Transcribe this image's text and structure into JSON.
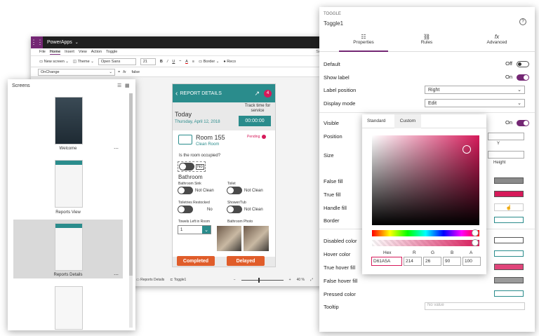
{
  "studio": {
    "app_name": "PowerApps",
    "user_hint": "SmartHo",
    "menu": [
      "File",
      "Home",
      "Insert",
      "View",
      "Action",
      "Toggle"
    ],
    "ribbon": {
      "new_screen": "New screen",
      "theme": "Theme",
      "font": "Open Sans",
      "font_size": "21",
      "bold": "B",
      "italic": "/",
      "underline": "U",
      "strike": "⎯",
      "font_color": "A",
      "align": "≡",
      "border": "Border",
      "record": "Reco"
    },
    "formula": {
      "property": "OnChange",
      "equals": "=",
      "fx": "fx",
      "value": "false"
    },
    "status": {
      "screen": "Reports Details",
      "control": "Toggle1",
      "zoom": "40 %"
    }
  },
  "screens_panel": {
    "title": "Screens",
    "items": [
      {
        "label": "Welcome"
      },
      {
        "label": "Reports View"
      },
      {
        "label": "Reports Details"
      },
      {
        "label": ""
      }
    ]
  },
  "app_screen": {
    "header": "REPORT DETAILS",
    "badge": "4",
    "today": "Today",
    "date": "Thursday, April 12, 2018",
    "track_label": "Track time for service",
    "timer": "00:00:00",
    "room": "Room 155",
    "room_sub": "Clean Room",
    "status": "Pending",
    "occupied_q": "Is the room occupied?",
    "occupied_val": "No",
    "section": "Bathroom",
    "sink_label": "Bathroom Sink",
    "sink_val": "Not Clean",
    "toilet_label": "Toilet",
    "toilet_val": "Not Clean",
    "toiletries_label": "Toiletries Restocked",
    "toiletries_val": "No",
    "shower_label": "Shower/Tub",
    "shower_val": "Not Clean",
    "towels_label": "Towels Left in Room",
    "towels_val": "1",
    "photo_label": "Bathroom Photo",
    "completed": "Completed",
    "delayed": "Delayed"
  },
  "props": {
    "kind": "TOGGLE",
    "name": "Toggle1",
    "help": "?",
    "tabs": [
      "Properties",
      "Rules",
      "Advanced"
    ],
    "default_label": "Default",
    "default_val": "Off",
    "show_label": "Show label",
    "show_val": "On",
    "label_pos": "Label position",
    "label_pos_val": "Right",
    "display_mode": "Display mode",
    "display_mode_val": "Edit",
    "visible": "Visible",
    "visible_val": "On",
    "position": "Position",
    "y": "Y",
    "size": "Size",
    "height": "Height",
    "false_fill": "False fill",
    "true_fill": "True fill",
    "handle_fill": "Handle fill",
    "border": "Border",
    "disabled_color": "Disabled color",
    "hover_color": "Hover color",
    "true_hover_fill": "True hover fill",
    "false_hover_fill": "False hover fill",
    "pressed_color": "Pressed color",
    "tooltip": "Tooltip",
    "tooltip_placeholder": "No value",
    "colors": {
      "false_fill": "#8a8a8a",
      "true_fill": "#d61a5a",
      "hover": "#ffffff",
      "true_hover": "#e0457a",
      "false_hover": "#9a9a9a",
      "pressed": "#ffffff"
    }
  },
  "picker": {
    "tabs": [
      "Standard",
      "Custom"
    ],
    "hex_label": "Hex",
    "r_label": "R",
    "g_label": "G",
    "b_label": "B",
    "a_label": "A",
    "hex": "D61A5A",
    "r": "214",
    "g": "26",
    "b": "90",
    "a": "100",
    "color": "#d61a5a"
  }
}
